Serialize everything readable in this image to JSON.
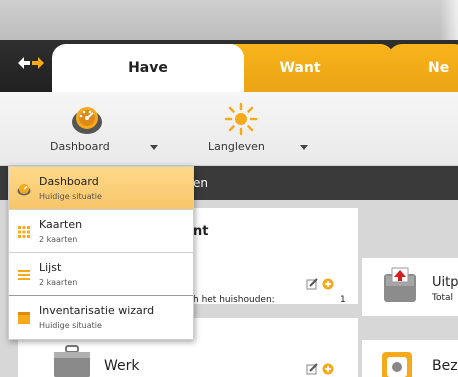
{
  "tabs": [
    {
      "label": "Have"
    },
    {
      "label": "Want"
    },
    {
      "label": "Ne"
    }
  ],
  "toolbar": {
    "dashboard_label": "Dashboard",
    "langleven_label": "Langleven"
  },
  "subheader": {
    "text": "en"
  },
  "dropdown": {
    "items": [
      {
        "title": "Dashboard",
        "subtitle": "Huidige situatie"
      },
      {
        "title": "Kaarten",
        "subtitle": "2 kaarten"
      },
      {
        "title": "Lijst",
        "subtitle": "2 kaarten"
      },
      {
        "title": "Inventarisatie wizard",
        "subtitle": "Huidige situatie"
      }
    ]
  },
  "content": {
    "peek_title": "nt",
    "peek_line": "h het huishouden:",
    "peek_count": "1",
    "uit_title": "Uitp",
    "uit_sub": "Total",
    "werk_title": "Werk",
    "bez_title": "Bez"
  },
  "colors": {
    "accent_orange": "#f5a91b",
    "dark_bar": "#2a2a2a",
    "dropdown_selected": "#f9cf78"
  }
}
